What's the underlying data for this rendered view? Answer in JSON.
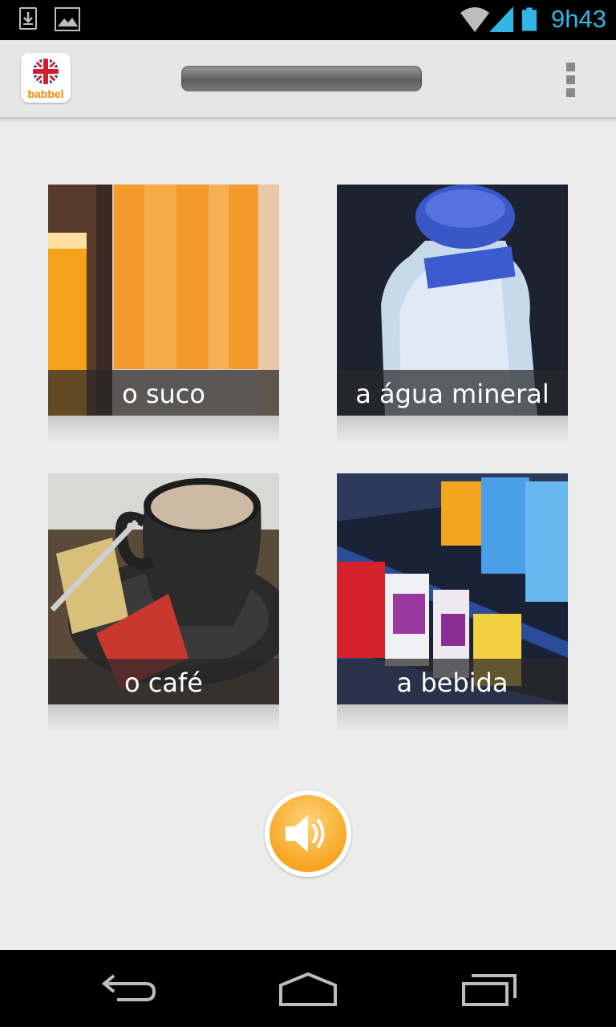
{
  "status_bar": {
    "time": "9h43",
    "icons": [
      "download-icon",
      "gallery-icon",
      "wifi-icon",
      "signal-icon",
      "battery-icon"
    ],
    "accent_color": "#33b5e5"
  },
  "action_bar": {
    "logo_text": "babbel",
    "logo_flag": "uk-flag-icon",
    "menu_icon": "overflow-menu-icon"
  },
  "cards": [
    {
      "label": "o suco",
      "image": "orange-juice-photo"
    },
    {
      "label": "a água mineral",
      "image": "water-bottle-photo"
    },
    {
      "label": "o café",
      "image": "coffee-cup-photo"
    },
    {
      "label": "a bebida",
      "image": "vending-drinks-photo"
    }
  ],
  "sound_button": {
    "icon": "speaker-icon",
    "color": "#f6a623"
  },
  "nav_bar": {
    "icons": [
      "back-icon",
      "home-icon",
      "recent-apps-icon"
    ]
  }
}
